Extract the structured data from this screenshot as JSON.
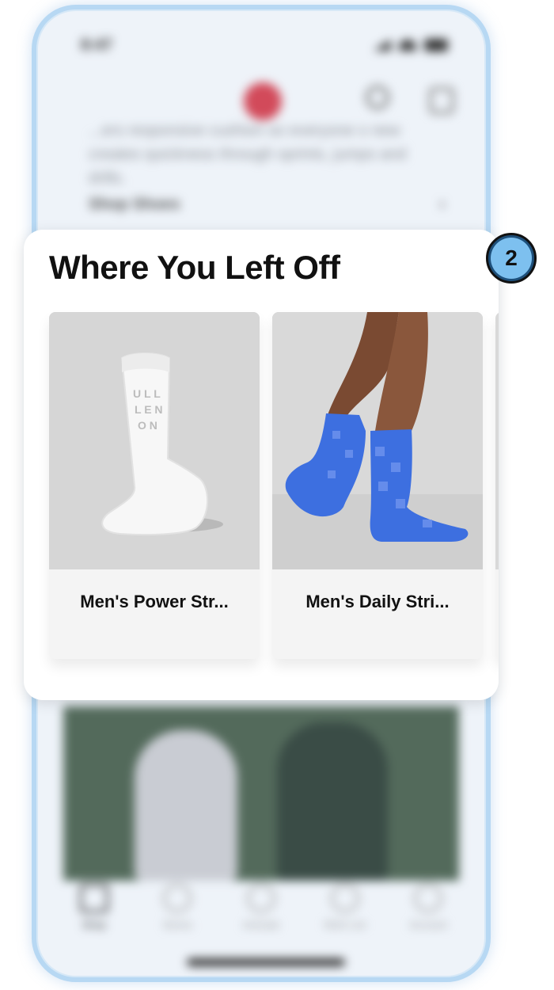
{
  "status_bar": {
    "time": "8:47"
  },
  "background": {
    "paragraph": "...ers responsive cushion so everyone s new creates quickness through sprints, jumps and drills.",
    "shop_link": "Shop Shoes",
    "shop_chevron": "›"
  },
  "tabbar": [
    {
      "label": "Shop"
    },
    {
      "label": "Stores"
    },
    {
      "label": "Activate"
    },
    {
      "label": "Wish List"
    },
    {
      "label": "Account"
    }
  ],
  "popup": {
    "title": "Where You Left Off",
    "products": [
      {
        "name": "Men's Power Str..."
      },
      {
        "name": "Men's Daily Stri..."
      }
    ]
  },
  "badge": {
    "number": "2"
  },
  "colors": {
    "frame": "#b7d8f3",
    "badge_outer": "#1d4f7a",
    "badge_inner": "#7dc0ef",
    "sock_white": "#ffffff",
    "sock_blue": "#3d6fe0"
  }
}
